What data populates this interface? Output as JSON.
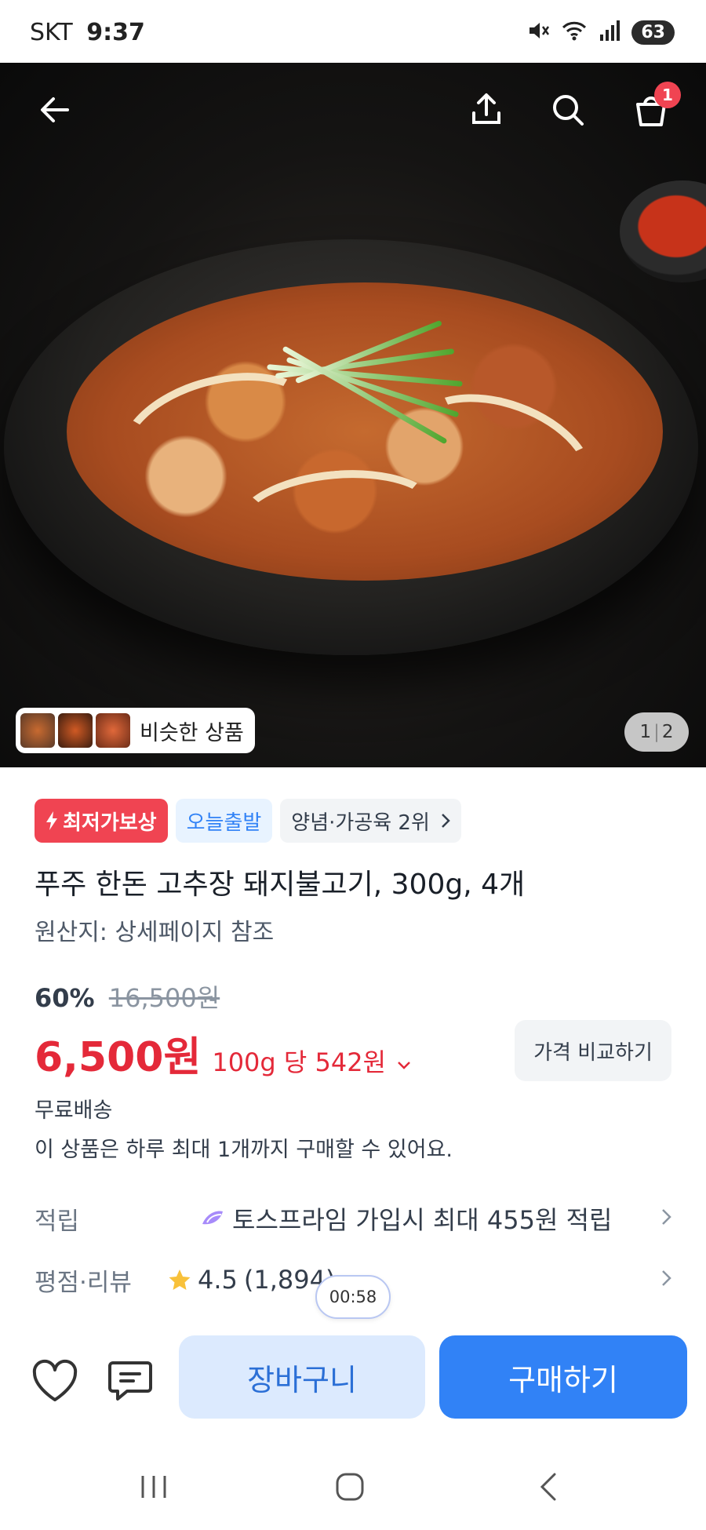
{
  "status_bar": {
    "carrier": "SKT",
    "time": "9:37",
    "battery": "63",
    "icons": [
      "mute-icon",
      "wifi-icon",
      "signal-icon",
      "battery-icon"
    ]
  },
  "hero": {
    "icons": [
      "back-icon",
      "share-icon",
      "search-icon",
      "shopping-bag-icon"
    ],
    "cart_badge_count": "1",
    "similar_products_label": "비슷한 상품",
    "page_current": "1",
    "page_total": "2"
  },
  "product": {
    "badges": {
      "lowest_price": "최저가보상",
      "today_ship": "오늘출발",
      "ranking": "양념·가공육 2위"
    },
    "title": "푸주 한돈 고추장 돼지불고기, 300g, 4개",
    "origin": "원산지: 상세페이지 참조",
    "discount_percent": "60%",
    "original_price": "16,500원",
    "price": "6,500원",
    "unit_price": "100g 당 542원",
    "compare_button": "가격 비교하기",
    "shipping": "무료배송",
    "purchase_limit": "이 상품은 하루 최대 1개까지 구매할 수 있어요."
  },
  "rows": {
    "reward_label": "적립",
    "reward_value": "토스프라임 가입시 최대 455원 적립",
    "review_label": "평점·리뷰",
    "rating": "4.5",
    "review_count": "(1,894)"
  },
  "timer": "00:58",
  "actions": {
    "cart_button": "장바구니",
    "buy_button": "구매하기"
  },
  "colors": {
    "primary_blue": "#3182f6",
    "price_red": "#e42939",
    "badge_red": "#f04452",
    "light_blue": "#dceafe"
  }
}
